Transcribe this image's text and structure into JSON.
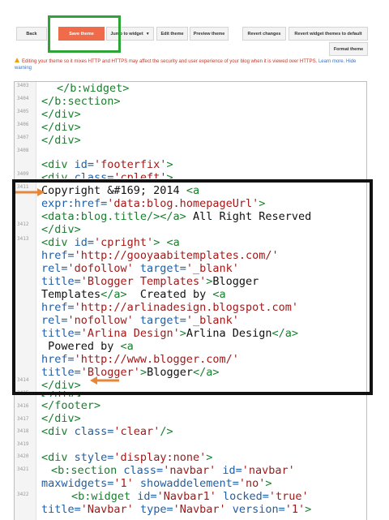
{
  "toolbar": {
    "back": "Back",
    "save_theme": "Save theme",
    "jump_to_widget": "Jump to widget",
    "edit_theme": "Edit theme",
    "preview_theme": "Preview theme",
    "revert_changes": "Revert changes",
    "revert_widget_themes": "Revert widget themes to default",
    "format_theme": "Format theme"
  },
  "warning": {
    "text": "Editing your theme so it mixes HTTP and HTTPS may affect the security and user experience of your blog when it is viewed over HTTPS.",
    "learn_more": "Learn more.",
    "hide_warning": "Hide warning"
  },
  "editor": {
    "line_numbers": [
      "3403",
      "3404",
      "3405",
      "3406",
      "3407",
      "3408",
      "3409",
      "3411",
      "3412",
      "3413",
      "3414",
      "3415",
      "3416",
      "3417",
      "3418",
      "3419",
      "3420",
      "3421",
      "3422"
    ],
    "code": {
      "l1": "</b:widget>",
      "l2": "</b:section>",
      "l3": "</div>",
      "l4": "</div>",
      "l5": "</div>",
      "l6_tag": "<div ",
      "l6_attr": "id=",
      "l6_val": "'footerfix'",
      "l6_end": ">",
      "l7_tag": "<div ",
      "l7_attr": "class=",
      "l7_val": "'cpleft'",
      "l7_end": ">",
      "l8_text": "Copyright &#169; 2014 ",
      "l8_tag": "<a",
      "l9_attr": "expr:href=",
      "l9_val": "'data:blog.homepageUrl'",
      "l9_end": ">",
      "l10_tag": "<data:blog.title/></a>",
      "l10_text": " All Right Reserved",
      "l11": "</div>",
      "l12_tag": "<div ",
      "l12_attr": "id=",
      "l12_val": "'cpright'",
      "l12_end": "> ",
      "l12_tag2": "<a",
      "l13_attr": "href=",
      "l13_val": "'http://gooyaabitemplates.com/'",
      "l14_attr": "rel=",
      "l14_val": "'dofollow'",
      "l14_attr2": " target=",
      "l14_val2": "'_blank'",
      "l15_attr": "title=",
      "l15_val": "'Blogger Templates'",
      "l15_end": ">",
      "l15_text": "Blogger",
      "l16_text": "Templates",
      "l16_tag": "</a>",
      "l16_text2": "  Created by ",
      "l16_tag2": "<a",
      "l17_attr": "href=",
      "l17_val": "'http://arlinadesign.blogspot.com'",
      "l18_attr": "rel=",
      "l18_val": "'nofollow'",
      "l18_attr2": " target=",
      "l18_val2": "'_blank'",
      "l19_attr": "title=",
      "l19_val": "'Arlina Design'",
      "l19_end": ">",
      "l19_text": "Arlina Design",
      "l19_tag": "</a>",
      "l20_text": " Powered by ",
      "l20_tag": "<a",
      "l21_attr": "href=",
      "l21_val": "'http://www.blogger.com/'",
      "l22_attr": "title=",
      "l22_val": "'Blogger'",
      "l22_end": ">",
      "l22_text": "Blogger",
      "l22_tag": "</a>",
      "l23": "</div>",
      "l24": "</div>",
      "l25": "</footer>",
      "l26": "</div>",
      "l27_tag": "<div ",
      "l27_attr": "class=",
      "l27_val": "'clear'",
      "l27_end": "/>",
      "l28_tag": "<div ",
      "l28_attr": "style=",
      "l28_val": "'display:none'",
      "l28_end": ">",
      "l29_tag": "<b:section ",
      "l29_attr": "class=",
      "l29_val": "'navbar'",
      "l29_attr2": " id=",
      "l29_val2": "'navbar'",
      "l30_attr": "maxwidgets=",
      "l30_val": "'1'",
      "l30_attr2": " showaddelement=",
      "l30_val2": "'no'",
      "l30_end": ">",
      "l31_tag": "<b:widget ",
      "l31_attr": "id=",
      "l31_val": "'Navbar1'",
      "l31_attr2": " locked=",
      "l31_val2": "'true'",
      "l32_attr": "title=",
      "l32_val": "'Navbar'",
      "l32_attr2": " type=",
      "l32_val2": "'Navbar'",
      "l32_attr3": " version=",
      "l32_val3": "'1'",
      "l32_end": ">"
    }
  },
  "colors": {
    "save_button": "#f06b4a",
    "highlight_box": "#2ca436",
    "annotation_arrow": "#e5873a",
    "annotation_box": "#111111"
  }
}
